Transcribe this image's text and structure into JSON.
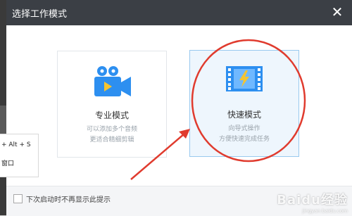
{
  "window": {
    "title": "选择工作模式",
    "close_glyph": "✕"
  },
  "modes": [
    {
      "name": "专业模式",
      "desc1": "可以添加多个音频",
      "desc2": "更适合精细剪辑",
      "icon": "video-camera-icon"
    },
    {
      "name": "快速模式",
      "desc1": "向导式操作",
      "desc2": "方便快速完成任务",
      "icon": "film-strip-icon"
    }
  ],
  "popup": {
    "line1": "+ Alt + S",
    "line2": "窗口"
  },
  "footer": {
    "checkbox_label": "下次启动时不再显示此提示"
  },
  "watermark": {
    "text": "Baidu经验",
    "sub": "jingyan.baidu.com"
  },
  "colors": {
    "accent": "#2d8ff0",
    "annotation": "#e03b2e",
    "titlebar": "#3b3f45"
  }
}
